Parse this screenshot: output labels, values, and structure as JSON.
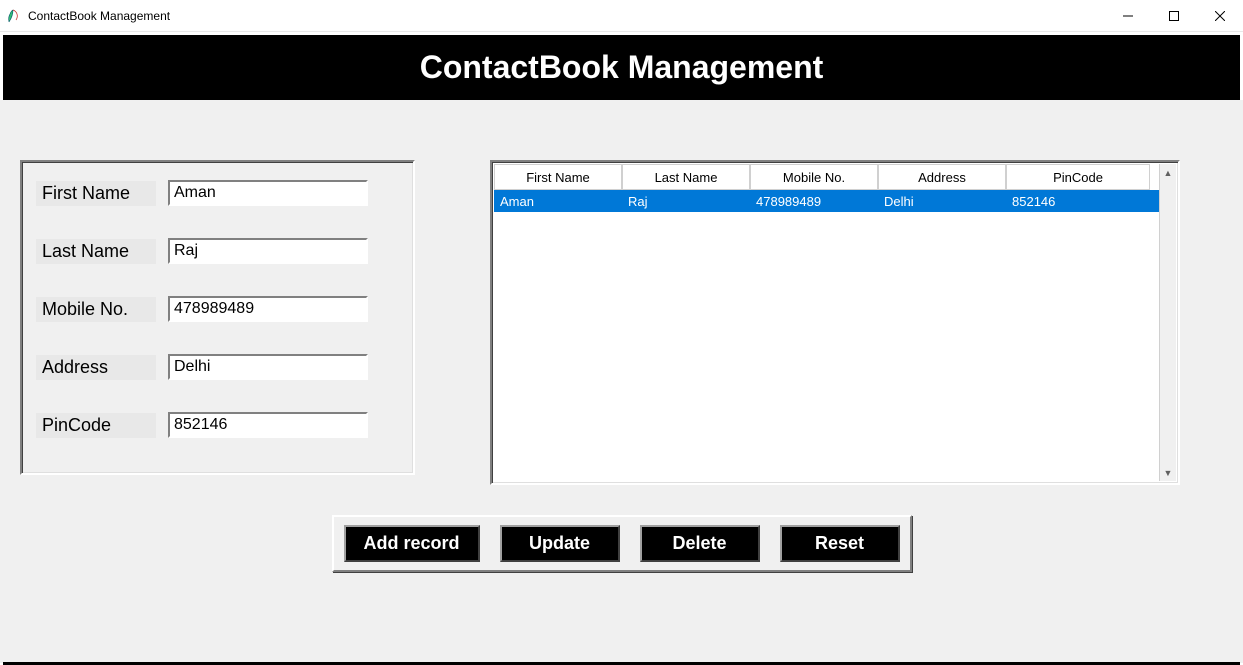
{
  "window": {
    "title": "ContactBook Management"
  },
  "header": {
    "title": "ContactBook Management"
  },
  "form": {
    "fields": [
      {
        "label": "First Name",
        "value": "Aman"
      },
      {
        "label": "Last Name",
        "value": "Raj"
      },
      {
        "label": "Mobile No.",
        "value": "478989489"
      },
      {
        "label": "Address",
        "value": "Delhi"
      },
      {
        "label": "PinCode",
        "value": "852146"
      }
    ]
  },
  "table": {
    "columns": [
      "First Name",
      "Last Name",
      "Mobile No.",
      "Address",
      "PinCode"
    ],
    "rows": [
      {
        "cells": [
          "Aman",
          "Raj",
          "478989489",
          "Delhi",
          "852146"
        ],
        "selected": true
      }
    ]
  },
  "buttons": {
    "add": "Add record",
    "update": "Update",
    "delete": "Delete",
    "reset": "Reset"
  }
}
